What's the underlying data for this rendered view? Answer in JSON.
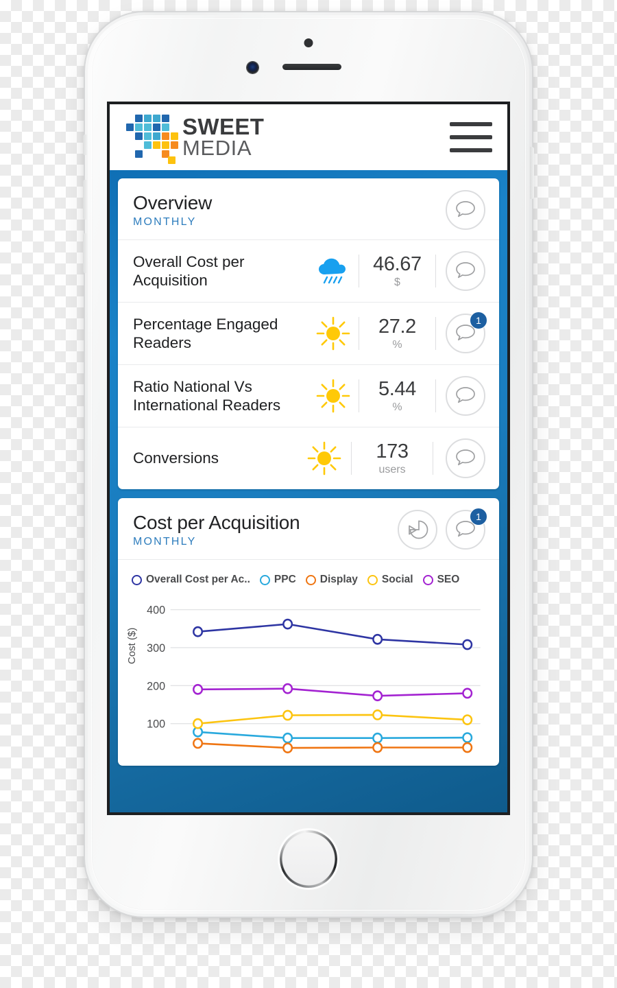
{
  "brand": {
    "name_top": "SWEET",
    "name_bottom": "MEDIA",
    "logo_icon": "pixel-grid-logo",
    "menu_icon": "hamburger-menu-icon"
  },
  "colors": {
    "app_blue": "#1a7dbf",
    "link_blue": "#2e7dbd",
    "badge_blue": "#1d5fa1",
    "sun_yellow": "#FFC907",
    "rain_blue": "#18a0ef",
    "series_overall": "#2e35a3",
    "series_ppc": "#29a9dd",
    "series_display": "#ef7512",
    "series_social": "#fcc410",
    "series_seo": "#a322d1"
  },
  "overview_card": {
    "title": "Overview",
    "subtitle": "MONTHLY",
    "comment_icon": "comment-bubble-icon",
    "rows": [
      {
        "name": "Overall Cost per Acquisition",
        "weather_icon": "rain-cloud-icon",
        "value": "46.67",
        "unit": "$",
        "comment_icon": "comment-bubble-icon",
        "badge": ""
      },
      {
        "name": "Percentage Engaged Readers",
        "weather_icon": "sun-icon",
        "value": "27.2",
        "unit": "%",
        "comment_icon": "comment-bubble-icon",
        "badge": "1"
      },
      {
        "name": "Ratio National Vs International Readers",
        "weather_icon": "sun-icon",
        "value": "5.44",
        "unit": "%",
        "comment_icon": "comment-bubble-icon",
        "badge": ""
      },
      {
        "name": "Conversions",
        "weather_icon": "sun-icon",
        "value": "173",
        "unit": "users",
        "comment_icon": "comment-bubble-icon",
        "badge": ""
      }
    ]
  },
  "cpa_card": {
    "title": "Cost per Acquisition",
    "subtitle": "MONTHLY",
    "drilldown_icon": "pie-arrow-icon",
    "comment_icon": "comment-bubble-icon",
    "badge": "1"
  },
  "chart_data": {
    "type": "line",
    "title": "Cost per Acquisition",
    "xlabel": "",
    "ylabel": "Cost ($)",
    "ylim": [
      0,
      430
    ],
    "yticks": [
      100,
      200,
      300,
      400
    ],
    "ytick_labels": [
      "100",
      "200",
      "300",
      "400"
    ],
    "grid": true,
    "legend_position": "top",
    "x": [
      1,
      2,
      3,
      4
    ],
    "categories": [
      "",
      "",
      "",
      ""
    ],
    "series": [
      {
        "name": "Overall Cost per Ac..",
        "color": "#2e35a3",
        "values": [
          342,
          362,
          322,
          308
        ]
      },
      {
        "name": "PPC",
        "color": "#29a9dd",
        "values": [
          78,
          62,
          62,
          63
        ]
      },
      {
        "name": "Display",
        "color": "#ef7512",
        "values": [
          48,
          36,
          37,
          37
        ]
      },
      {
        "name": "Social",
        "color": "#fcc410",
        "values": [
          100,
          122,
          123,
          110
        ]
      },
      {
        "name": "SEO",
        "color": "#a322d1",
        "values": [
          190,
          192,
          173,
          180
        ]
      }
    ]
  }
}
